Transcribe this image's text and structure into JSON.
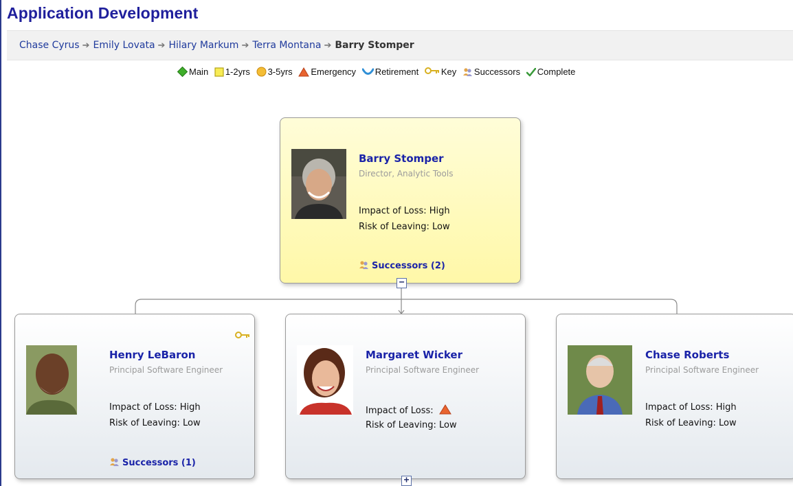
{
  "page": {
    "title": "Application Development"
  },
  "breadcrumb": {
    "items": [
      "Chase Cyrus",
      "Emily Lovata",
      "Hilary Markum",
      "Terra Montana"
    ],
    "current": "Barry Stomper"
  },
  "legend": [
    {
      "label": "Main",
      "icon": "diamond-icon",
      "color": "#3fae2a"
    },
    {
      "label": "1-2yrs",
      "icon": "square-icon",
      "color": "#f2e53a"
    },
    {
      "label": "3-5yrs",
      "icon": "circle-icon",
      "color": "#f0b429"
    },
    {
      "label": "Emergency",
      "icon": "triangle-icon",
      "color": "#e0542a"
    },
    {
      "label": "Retirement",
      "icon": "smile-icon",
      "color": "#2f8fd6"
    },
    {
      "label": "Key",
      "icon": "key-icon",
      "color": "#e8c43a"
    },
    {
      "label": "Successors",
      "icon": "people-icon",
      "color": "#e0a040"
    },
    {
      "label": "Complete",
      "icon": "check-icon",
      "color": "#3a9a3a"
    }
  ],
  "main_card": {
    "name": "Barry Stomper",
    "role": "Director, Analytic Tools",
    "impact": "Impact of Loss: High",
    "risk": "Risk of Leaving: Low",
    "successors": "Successors (2)",
    "toggle": "−"
  },
  "children": [
    {
      "name": "Henry LeBaron",
      "role": "Principal Software Engineer",
      "impact": "Impact of Loss: High",
      "risk": "Risk of Leaving: Low",
      "successors": "Successors (1)",
      "key_badge": "key-icon"
    },
    {
      "name": "Margaret Wicker",
      "role": "Principal Software Engineer",
      "impact": "Impact of Loss:",
      "impact_icon": "triangle-icon",
      "risk": "Risk of Leaving: Low",
      "toggle": "+"
    },
    {
      "name": "Chase Roberts",
      "role": "Principal Software Engineer",
      "impact": "Impact of Loss: High",
      "risk": "Risk of Leaving: Low"
    }
  ]
}
